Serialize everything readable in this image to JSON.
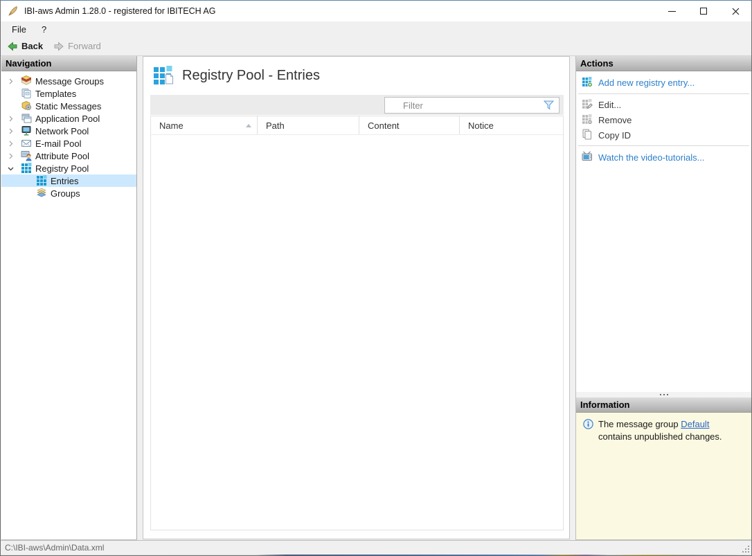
{
  "window": {
    "title": "IBI-aws Admin 1.28.0 - registered for IBITECH AG"
  },
  "menubar": {
    "items": [
      {
        "label": "File"
      },
      {
        "label": "?"
      }
    ]
  },
  "toolbar": {
    "back": "Back",
    "forward": "Forward"
  },
  "navigation": {
    "header": "Navigation",
    "items": [
      {
        "label": "Message Groups",
        "expander": "collapsed",
        "level": 0
      },
      {
        "label": "Templates",
        "expander": "none",
        "level": 0
      },
      {
        "label": "Static Messages",
        "expander": "none",
        "level": 0
      },
      {
        "label": "Application Pool",
        "expander": "collapsed",
        "level": 0
      },
      {
        "label": "Network Pool",
        "expander": "collapsed",
        "level": 0
      },
      {
        "label": "E-mail Pool",
        "expander": "collapsed",
        "level": 0
      },
      {
        "label": "Attribute Pool",
        "expander": "collapsed",
        "level": 0
      },
      {
        "label": "Registry Pool",
        "expander": "expanded",
        "level": 0
      },
      {
        "label": "Entries",
        "expander": "none",
        "level": 1,
        "selected": true
      },
      {
        "label": "Groups",
        "expander": "none",
        "level": 1
      }
    ]
  },
  "main": {
    "title": "Registry Pool - Entries",
    "filter": {
      "placeholder": "Filter"
    },
    "table": {
      "columns": [
        {
          "label": "Name",
          "sorted": "asc"
        },
        {
          "label": "Path"
        },
        {
          "label": "Content"
        },
        {
          "label": "Notice"
        }
      ],
      "rows": []
    }
  },
  "actions": {
    "header": "Actions",
    "items": [
      {
        "label": "Add new registry entry...",
        "enabled": true
      },
      {
        "label": "Edit...",
        "enabled": false
      },
      {
        "label": "Remove",
        "enabled": false
      },
      {
        "label": "Copy ID",
        "enabled": false
      },
      {
        "label": "Watch the video-tutorials...",
        "enabled": true
      }
    ]
  },
  "information": {
    "header": "Information",
    "message": {
      "prefix": "The message group ",
      "link": "Default",
      "suffix": " contains unpublished changes."
    }
  },
  "statusbar": {
    "file_path": "C:\\IBI-aws\\Admin\\Data.xml"
  },
  "colors": {
    "link_blue": "#2e80cc",
    "selection_blue": "#cce8ff",
    "info_yellow": "#fbf9e1",
    "registry_blue": "#1d9ad0"
  }
}
